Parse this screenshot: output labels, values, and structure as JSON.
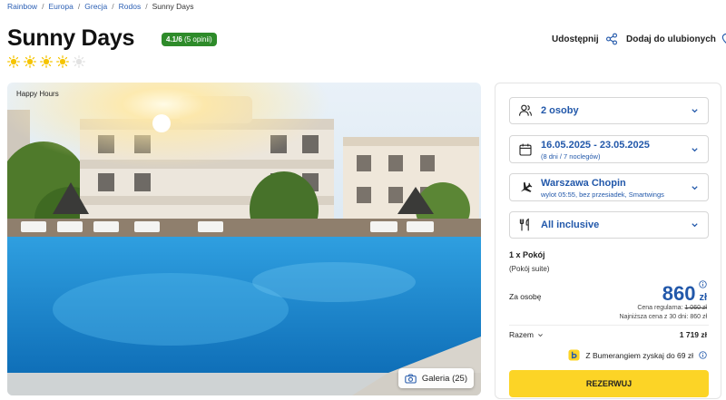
{
  "breadcrumb": [
    "Rainbow",
    "Europa",
    "Grecja",
    "Rodos",
    "Sunny Days"
  ],
  "hotel": {
    "name": "Sunny Days",
    "rating_score": "4.1/6",
    "rating_count": "(5 opinii)",
    "stars_filled": 4,
    "stars_total": 5
  },
  "actions": {
    "share_label": "Udostępnij",
    "favorite_label": "Dodaj do ulubionych"
  },
  "photo": {
    "tag": "Happy Hours",
    "gallery_label": "Galeria (25)"
  },
  "booking": {
    "persons": "2 osoby",
    "dates": "16.05.2025 - 23.05.2025",
    "dates_sub": "(8 dni / 7 noclegów)",
    "departure": "Warszawa Chopin",
    "departure_sub": "wylot 05:55, bez przesiadek, Smartwings",
    "board": "All inclusive",
    "room_count": "1 x Pokój",
    "room_type": "(Pokój suite)",
    "per_person_label": "Za osobę",
    "price_amount": "860",
    "price_currency": "zł",
    "regular_label": "Cena regularna:",
    "regular_price": "1 060 zł",
    "lowest_label": "Najniższa cena z 30 dni: 860 zł",
    "total_label": "Razem",
    "total_value": "1 719 zł",
    "bumerang_text": "Z Bumerangiem zyskaj do 69 zł",
    "reserve_label": "REZERWUJ"
  },
  "colors": {
    "link_blue": "#2258aa",
    "rating_green": "#2e8b2a",
    "star_yellow": "#f5c400",
    "star_empty": "#e2e2e2",
    "cta_yellow": "#fcd426"
  }
}
